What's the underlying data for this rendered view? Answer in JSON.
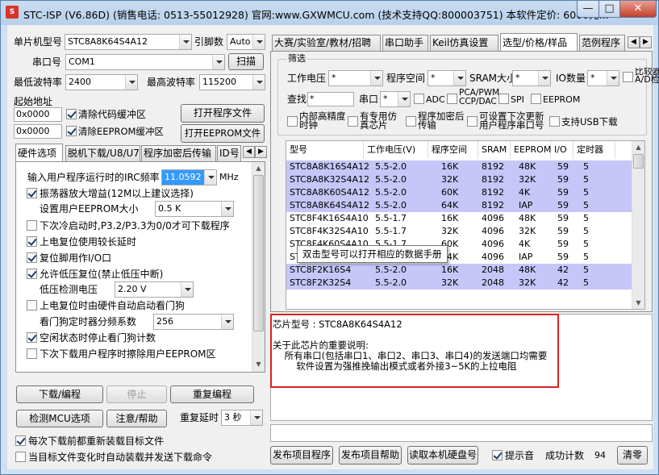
{
  "window": {
    "title": "STC-ISP (V6.86D) (销售电话: 0513-55012928) 官网:www.GXWMCU.com  (技术支持QQ:800003751) 本软件定价: 6000元...",
    "min": "—",
    "max": "□",
    "close": "✕"
  },
  "left": {
    "mcu_type_label": "单片机型号",
    "mcu_type_value": "STC8A8K64S4A12",
    "pin_label": "引脚数",
    "pin_value": "Auto",
    "port_label": "串口号",
    "port_value": "COM1",
    "scan_button": "扫描",
    "min_baud_label": "最低波特率",
    "min_baud_value": "2400",
    "max_baud_label": "最高波特率",
    "max_baud_value": "115200",
    "start_addr_label": "起始地址",
    "addr1": "0x0000",
    "clear_code_label": "清除代码缓冲区",
    "open_prog_button": "打开程序文件",
    "addr2": "0x0000",
    "clear_eeprom_label": "清除EEPROM缓冲区",
    "open_eeprom_button": "打开EEPROM文件",
    "tabs": [
      "硬件选项",
      "脱机下载/U8/U7",
      "程序加密后传输",
      "ID号"
    ],
    "hw": {
      "irc_label": "输入用户程序运行时的IRC频率",
      "irc_value": "11.0592",
      "irc_unit": "MHz",
      "osc_label": "振荡器放大增益(12M以上建议选择)",
      "eeprom_size_label": "设置用户EEPROM大小",
      "eeprom_size_value": "0.5 K",
      "cold_start_label": "下次冷启动时,P3.2/P3.3为0/0才可下载程序",
      "por_delay_label": "上电复位使用较长延时",
      "reset_io_label": "复位脚用作I/O口",
      "lvr_label": "允许低压复位(禁止低压中断)",
      "lvd_label": "低压检测电压",
      "lvd_value": "2.20 V",
      "wdt_hw_label": "上电复位时由硬件自动启动看门狗",
      "wdt_div_label": "看门狗定时器分频系数",
      "wdt_div_value": "256",
      "idle_wdt_label": "空闲状态时停止看门狗计数",
      "erase_eeprom_label": "下次下载用户程序时擦除用户EEPROM区"
    },
    "download_button": "下载/编程",
    "stop_button": "停止",
    "reprogram_button": "重复编程",
    "detect_button": "检测MCU选项",
    "help_button": "注意/帮助",
    "retry_delay_label": "重复延时",
    "retry_delay_value": "3 秒",
    "reload_label": "每次下载前都重新装载目标文件",
    "auto_label": "当目标文件变化时自动装载并发送下载命令"
  },
  "right": {
    "tabs": [
      "大赛/实验室/教材/招聘",
      "串口助手",
      "Keil仿真设置",
      "选型/价格/样品",
      "范例程序"
    ],
    "filter_label": "筛选",
    "voltage_label": "工作电压",
    "voltage_value": "*",
    "prog_space_label": "程序空间",
    "prog_space_value": "*",
    "sram_label": "SRAM大小",
    "sram_value": "*",
    "io_label": "IO数量",
    "io_value": "*",
    "comparator_label": "比较器(可当A/D检测)",
    "search_label": "查找",
    "search_value": "*",
    "uart_label": "串口",
    "uart_value": "*",
    "adc_label": "ADC",
    "pca_label": "PCA/PWM CCP/DAC",
    "spi_label": "SPI",
    "eeprom_label": "EEPROM",
    "clock_label": "内部高精度时钟",
    "dedicated_label": "有专用仿真芯片",
    "encrypt_label": "程序加密后传输",
    "custom_uart_label": "可设置下次更新用户程序串口号",
    "usb_label": "支持USB下载",
    "table": {
      "headers": [
        "型号",
        "工作电压(V)",
        "程序空间",
        "SRAM",
        "EEPROM",
        "I/O",
        "定时器"
      ],
      "rows": [
        {
          "model": "STC8A8K16S4A12",
          "v": "5.5-2.0",
          "flash": "16K",
          "sram": "8192",
          "eeprom": "48K",
          "io": "59",
          "t": "5",
          "sel": true
        },
        {
          "model": "STC8A8K32S4A12",
          "v": "5.5-2.0",
          "flash": "32K",
          "sram": "8192",
          "eeprom": "32K",
          "io": "59",
          "t": "5",
          "sel": true
        },
        {
          "model": "STC8A8K60S4A12",
          "v": "5.5-2.0",
          "flash": "60K",
          "sram": "8192",
          "eeprom": "4K",
          "io": "59",
          "t": "5",
          "sel": true
        },
        {
          "model": "STC8A8K64S4A12",
          "v": "5.5-2.0",
          "flash": "64K",
          "sram": "8192",
          "eeprom": "IAP",
          "io": "59",
          "t": "5",
          "sel": true
        },
        {
          "model": "STC8F4K16S4A10",
          "v": "5.5-1.7",
          "flash": "16K",
          "sram": "4096",
          "eeprom": "48K",
          "io": "59",
          "t": "5",
          "sel": false
        },
        {
          "model": "STC8F4K32S4A10",
          "v": "5.5-1.7",
          "flash": "32K",
          "sram": "4096",
          "eeprom": "32K",
          "io": "59",
          "t": "5",
          "sel": false
        },
        {
          "model": "STC8F4K60S4A10",
          "v": "5.5-1.7",
          "flash": "60K",
          "sram": "4096",
          "eeprom": "4K",
          "io": "59",
          "t": "5",
          "sel": false
        },
        {
          "model": "STC8F4K64S4A10",
          "v": "5.5-1.7",
          "flash": "64K",
          "sram": "4096",
          "eeprom": "IAP",
          "io": "59",
          "t": "5",
          "sel": false
        },
        {
          "model": "STC8F2K16S4",
          "v": "5.5-2.0",
          "flash": "16K",
          "sram": "2048",
          "eeprom": "48K",
          "io": "42",
          "t": "5",
          "sel": true
        },
        {
          "model": "STC8F2K32S4",
          "v": "5.5-2.0",
          "flash": "32K",
          "sram": "2048",
          "eeprom": "32K",
          "io": "42",
          "t": "5",
          "sel": true
        }
      ]
    },
    "tooltip": "双击型号可以打开相应的数据手册",
    "info_text": "芯片型号 : STC8A8K64S4A12\n\n关于此芯片的重要说明:\n    所有串口(包括串口1、串口2、串口3、串口4)的发送端口均需要\n        软件设置为强推挽输出模式或者外接3~5K的上拉电阻",
    "publish_button": "发布项目程序",
    "publish_help_button": "发布项目帮助",
    "read_disk_button": "读取本机硬盘号",
    "beep_label": "提示音",
    "success_label": "成功计数",
    "success_value": "94",
    "clear_button": "清零"
  },
  "colors": {
    "selected_row": "#c6c6f8",
    "red_box": "#e02020",
    "window_frame": "#cfe0f4"
  }
}
